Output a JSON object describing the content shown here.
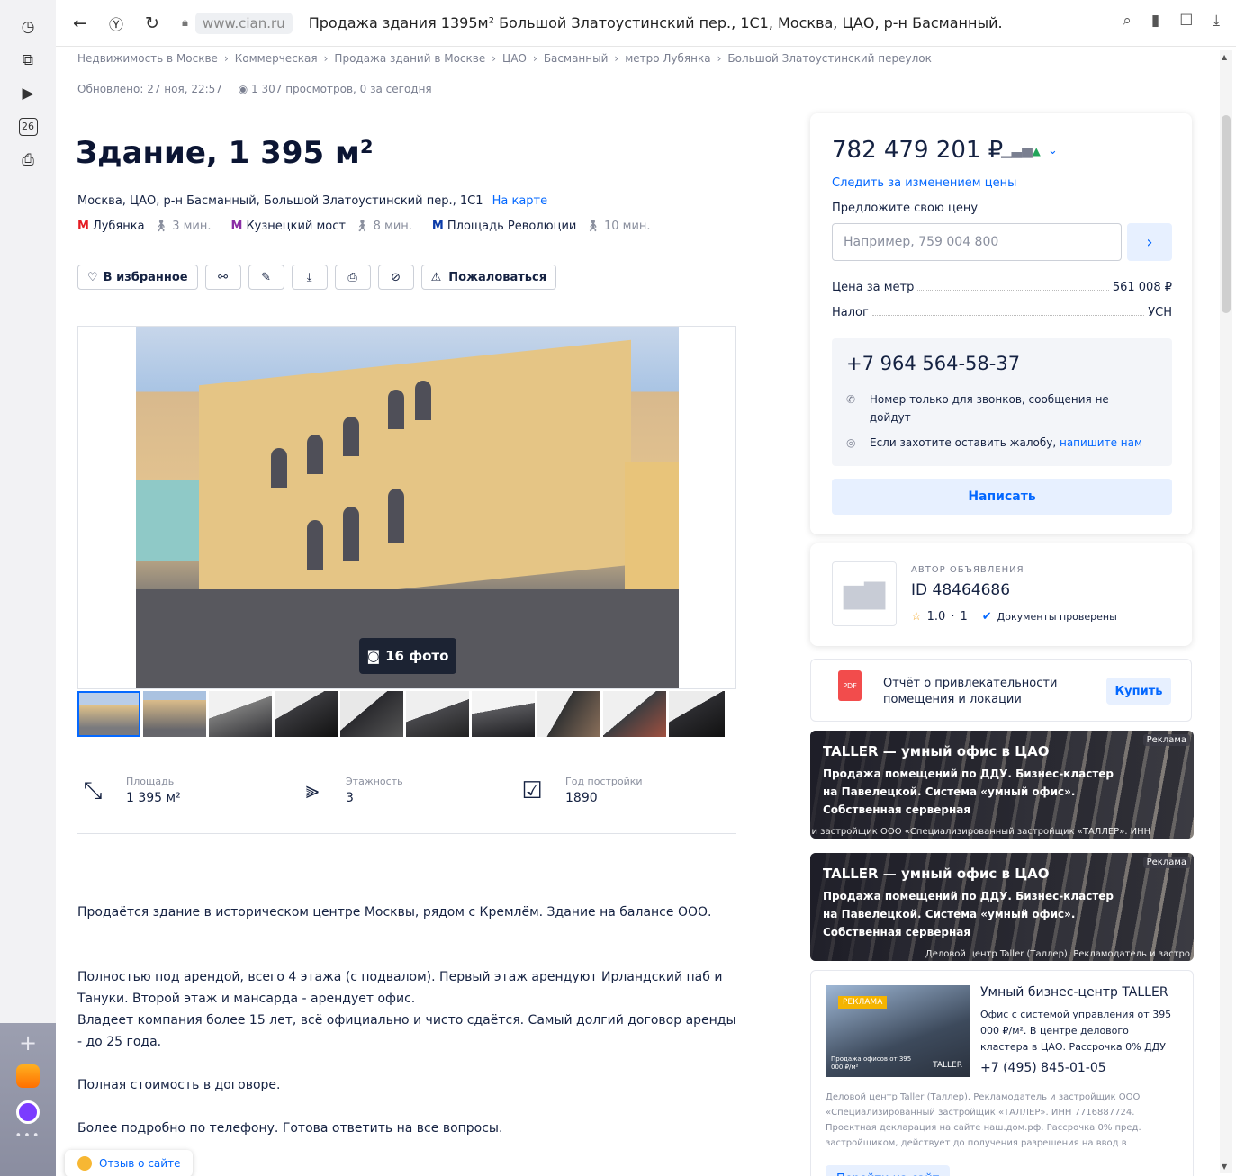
{
  "browser": {
    "domain": "www.cian.ru",
    "tab_title": "Продажа здания 1395м² Большой Златоустинский пер., 1С1, Москва, ЦАО, р-н Басманный...",
    "sidebar_day": "26"
  },
  "breadcrumbs": [
    "Недвижимость в Москве",
    "Коммерческая",
    "Продажа зданий в Москве",
    "ЦАО",
    "Басманный",
    "метро Лубянка",
    "Большой Златоустинский переулок"
  ],
  "meta": {
    "updated": "Обновлено: 27 ноя, 22:57",
    "views": "1 307 просмотров, 0 за сегодня"
  },
  "listing": {
    "title": "Здание, 1 395 м²",
    "address": "Москва, ЦАО, р-н Басманный, Большой Златоустинский пер., 1С1",
    "map_link": "На карте",
    "metro": [
      {
        "name": "Лубянка",
        "walk": "3 мин.",
        "color": "#e51c23"
      },
      {
        "name": "Кузнецкий мост",
        "walk": "8 мин.",
        "color": "#8a2ea5"
      },
      {
        "name": "Площадь Революции",
        "walk": "10 мин.",
        "color": "#0b3ba8"
      }
    ]
  },
  "actions": {
    "favorite": "В избранное",
    "complain": "Пожаловаться"
  },
  "gallery": {
    "photo_count": "16 фото",
    "thumb_count": 10
  },
  "facts": [
    {
      "label": "Площадь",
      "value": "1 395 м²",
      "icon": "area-icon"
    },
    {
      "label": "Этажность",
      "value": "3",
      "icon": "floors-icon"
    },
    {
      "label": "Год постройки",
      "value": "1890",
      "icon": "calendar-icon"
    }
  ],
  "description": [
    "Продаётся здание в историческом центре Москвы, рядом с Кремлём. Здание на балансе ООО.",
    "Полностью под арендой, всего 4 этажа (с подвалом). Первый этаж арендуют Ирландский паб и Тануки. Второй этаж и мансарда - арендует офис.",
    "Владеет компания более 15 лет, всё официально и чисто сдаётся. Самый долгий договор аренды - до 25 года.",
    "Полная стоимость в договоре.",
    "Более подробно по телефону. Готова ответить на все вопросы."
  ],
  "feedback": "Отзыв о сайте",
  "price_card": {
    "price": "782 479 201 ₽",
    "follow": "Следить за изменением цены",
    "offer_label": "Предложите свою цену",
    "offer_placeholder": "Например, 759 004 800",
    "per_meter_label": "Цена за метр",
    "per_meter_value": "561 008 ₽",
    "tax_label": "Налог",
    "tax_value": "УСН",
    "phone": "+7 964 564-58-37",
    "note1": "Номер только для звонков, сообщения не дойдут",
    "note2_prefix": "Если захотите оставить жалобу, ",
    "note2_link": "напишите нам",
    "write": "Написать"
  },
  "author": {
    "caption": "АВТОР ОБЪЯВЛЕНИЯ",
    "id": "ID 48464686",
    "rating": "1.0",
    "reviews": "1",
    "verified": "Документы проверены"
  },
  "report": {
    "pdf": "PDF",
    "text": "Отчёт о привлекательности помещения и локации",
    "buy": "Купить"
  },
  "ads": [
    {
      "tag": "Реклама",
      "title": "TALLER — умный офис в ЦАО",
      "text": "Продажа помещений по ДДУ. Бизнес-кластер на Павелецкой. Система «умный офис». Собственная серверная",
      "footer": "ль и застройщик ООО «Специализированный застройщик «ТАЛЛЕР». ИНН"
    },
    {
      "tag": "Реклама",
      "title": "TALLER — умный офис в ЦАО",
      "text": "Продажа помещений по ДДУ. Бизнес-кластер на Павелецкой. Система «умный офис». Собственная серверная",
      "footer": "Деловой центр Taller (Таллер). Рекламодатель и застро"
    }
  ],
  "ad_card": {
    "img_tag": "РЕКЛАМА",
    "img_caption": "Продажа офисов от 395 000 ₽/м²",
    "img_brand": "TALLER",
    "title": "Умный бизнес-центр TALLER",
    "sub": "Офис с системой управления от 395 000 ₽/м². В центре делового кластера в ЦАО. Рассрочка 0% ДДУ",
    "phone": "+7 (495) 845-01-05",
    "legal": "Деловой центр Taller (Таллер). Рекламодатель и застройщик ООО «Специализированный застройщик «ТАЛЛЕР». ИНН 7716887724. Проектная декларация на сайте наш.дом.рф. Рассрочка 0% пред. застройщиком, действует до получения разрешения на ввод в",
    "goto": "Перейти на сайт"
  }
}
